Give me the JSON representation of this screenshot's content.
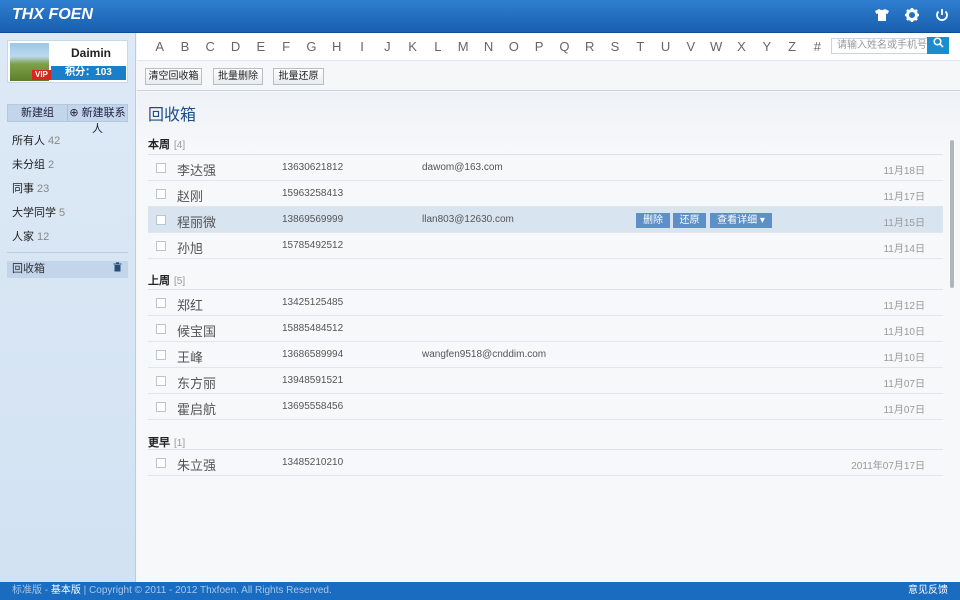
{
  "app": {
    "logo": "THX FOEN"
  },
  "header_icons": [
    "tshirt-icon",
    "gear-icon",
    "power-icon"
  ],
  "user": {
    "name": "Daimin",
    "badge": "VIP",
    "points": "积分：103"
  },
  "group_buttons": {
    "new_group": "新建组",
    "new_contact": "⊕ 新建联系人"
  },
  "groups": [
    {
      "label": "所有人",
      "count": "42"
    },
    {
      "label": "未分组",
      "count": "2"
    },
    {
      "label": "同事",
      "count": "23"
    },
    {
      "label": "大学同学",
      "count": "5"
    },
    {
      "label": "人家",
      "count": "12"
    }
  ],
  "trash": {
    "label": "回收箱"
  },
  "alphabet": [
    "A",
    "B",
    "C",
    "D",
    "E",
    "F",
    "G",
    "H",
    "I",
    "J",
    "K",
    "L",
    "M",
    "N",
    "O",
    "P",
    "Q",
    "R",
    "S",
    "T",
    "U",
    "V",
    "W",
    "X",
    "Y",
    "Z",
    "#"
  ],
  "search": {
    "placeholder": "请输入姓名或手机号"
  },
  "toolbar": {
    "empty": "清空回收箱",
    "batch_delete": "批量删除",
    "batch_restore": "批量还原"
  },
  "page_title": "回收箱",
  "sections": [
    {
      "title": "本周",
      "count": "[4]"
    },
    {
      "title": "上周",
      "count": "[5]"
    },
    {
      "title": "更早",
      "count": "[1]"
    }
  ],
  "contacts": [
    {
      "name": "李达强",
      "phone": "13630621812",
      "email": "dawom@163.com",
      "date": "11月18日"
    },
    {
      "name": "赵刚",
      "phone": "15963258413",
      "email": "",
      "date": "11月17日"
    },
    {
      "name": "程丽微",
      "phone": "13869569999",
      "email": "llan803@12630.com",
      "date": "11月15日"
    },
    {
      "name": "孙旭",
      "phone": "15785492512",
      "email": "",
      "date": "11月14日"
    },
    {
      "name": "郑红",
      "phone": "13425125485",
      "email": "",
      "date": "11月12日"
    },
    {
      "name": "候宝国",
      "phone": "15885484512",
      "email": "",
      "date": "11月10日"
    },
    {
      "name": "王峰",
      "phone": "13686589994",
      "email": "wangfen9518@cnddim.com",
      "date": "11月10日"
    },
    {
      "name": "东方丽",
      "phone": "13948591521",
      "email": "",
      "date": "11月07日"
    },
    {
      "name": "霍启航",
      "phone": "13695558456",
      "email": "",
      "date": "11月07日"
    },
    {
      "name": "朱立强",
      "phone": "13485210210",
      "email": "",
      "date": "2011年07月17日"
    }
  ],
  "row_actions": {
    "delete": "删除",
    "restore": "还原",
    "details": "查看详细 ▾"
  },
  "footer": {
    "standard": "标准版",
    "basic": "基本版",
    "copyright": "| Copyright © 2011 - 2012 Thxfoen. All Rights Reserved.",
    "feedback": "意见反馈"
  }
}
